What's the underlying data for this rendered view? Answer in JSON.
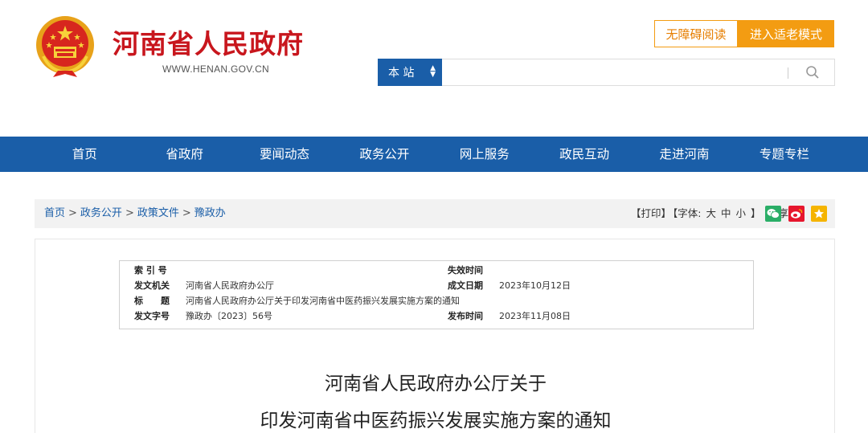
{
  "header": {
    "site_title": "河南省人民政府",
    "site_url": "WWW.HENAN.GOV.CN",
    "accessible_reading": "无障碍阅读",
    "elder_mode": "进入适老模式",
    "search_scope": "本 站",
    "search_placeholder": ""
  },
  "nav": {
    "items": [
      "首页",
      "省政府",
      "要闻动态",
      "政务公开",
      "网上服务",
      "政民互动",
      "走进河南",
      "专题专栏"
    ]
  },
  "breadcrumb": {
    "items": [
      "首页",
      "政务公开",
      "政策文件",
      "豫政办"
    ],
    "separator": ">"
  },
  "tools": {
    "print": "【打印】",
    "font_label": "【字体:",
    "font_large": "大",
    "font_medium": "中",
    "font_small": "小",
    "font_close": "】",
    "share_label": "分享:"
  },
  "share_icons": [
    "wechat-icon",
    "weibo-icon",
    "favorite-icon"
  ],
  "colors": {
    "brand_red": "#c8161d",
    "nav_blue": "#1a5ea8",
    "orange": "#f39c12",
    "wechat_green": "#2aae67",
    "weibo_red": "#e6162d",
    "star_yellow": "#f5b400"
  },
  "meta": {
    "index_no_label": "索 引 号",
    "index_no_value": "",
    "expire_label": "失效时间",
    "expire_value": "",
    "issuer_label": "发文机关",
    "issuer_value": "河南省人民政府办公厅",
    "created_label": "成文日期",
    "created_value": "2023年10月12日",
    "title_label": "标　　题",
    "title_value": "河南省人民政府办公厅关于印发河南省中医药振兴发展实施方案的通知",
    "docno_label": "发文字号",
    "docno_value": "豫政办〔2023〕56号",
    "publish_label": "发布时间",
    "publish_value": "2023年11月08日"
  },
  "document": {
    "title_line1": "河南省人民政府办公厅关于",
    "title_line2": "印发河南省中医药振兴发展实施方案的通知"
  }
}
